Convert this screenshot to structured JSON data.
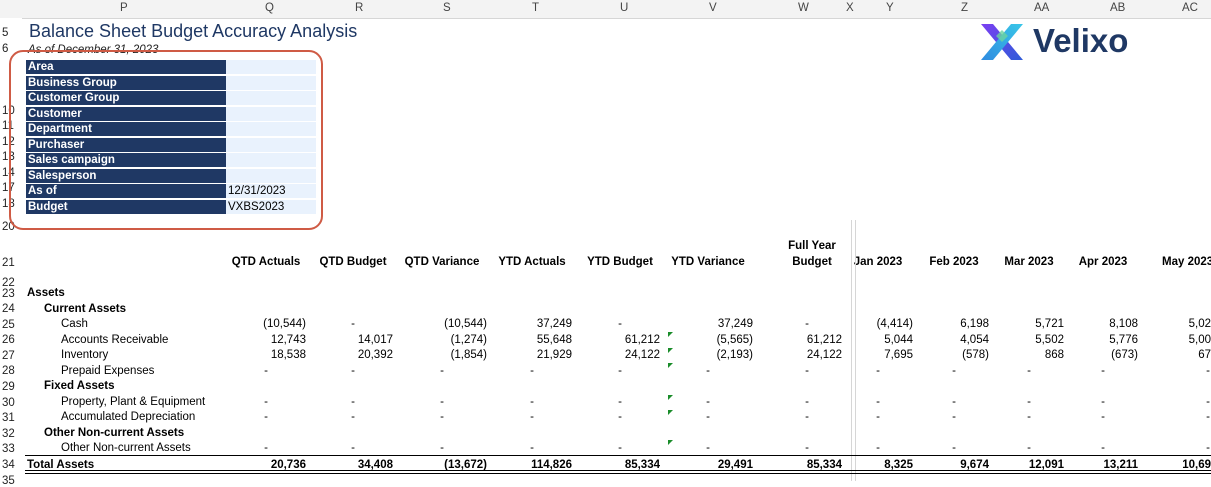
{
  "columns": [
    "P",
    "Q",
    "R",
    "S",
    "T",
    "U",
    "V",
    "W",
    "X",
    "Y",
    "Z",
    "AA",
    "AB",
    "AC"
  ],
  "row_numbers": [
    "5",
    "6",
    "",
    "",
    "",
    "10",
    "11",
    "12",
    "13",
    "14",
    "17",
    "18",
    "20",
    "21",
    "22",
    "23",
    "24",
    "25",
    "26",
    "27",
    "28",
    "29",
    "30",
    "31",
    "32",
    "33",
    "34",
    "35"
  ],
  "report": {
    "title": "Balance Sheet Budget Accuracy Analysis",
    "as_of_line": "As of December 31, 2023"
  },
  "logo": {
    "text": "Velixo",
    "icon": "velixo-x-logo"
  },
  "filters": [
    {
      "label": "Area",
      "value": ""
    },
    {
      "label": "Business Group",
      "value": ""
    },
    {
      "label": "Customer Group",
      "value": ""
    },
    {
      "label": "Customer",
      "value": ""
    },
    {
      "label": "Department",
      "value": ""
    },
    {
      "label": "Purchaser",
      "value": ""
    },
    {
      "label": "Sales campaign",
      "value": ""
    },
    {
      "label": "Salesperson",
      "value": ""
    },
    {
      "label": "As of",
      "value": "12/31/2023"
    },
    {
      "label": "Budget",
      "value": "VXBS2023"
    }
  ],
  "table": {
    "headers": [
      "QTD Actuals",
      "QTD Budget",
      "QTD Variance",
      "YTD Actuals",
      "YTD Budget",
      "YTD Variance",
      "Full Year Budget",
      "Jan 2023",
      "Feb 2023",
      "Mar 2023",
      "Apr 2023",
      "May 2023"
    ],
    "header_fy_line1": "Full Year",
    "header_fy_line2": "Budget",
    "rows": [
      {
        "label": "Assets",
        "style": "section",
        "values": []
      },
      {
        "label": "Current Assets",
        "style": "group",
        "values": []
      },
      {
        "label": "Cash",
        "style": "item",
        "values": [
          "(10,544)",
          "-",
          "(10,544)",
          "37,249",
          "-",
          "37,249",
          "-",
          "(4,414)",
          "6,198",
          "5,721",
          "8,108",
          "5,02"
        ]
      },
      {
        "label": "Accounts Receivable",
        "style": "item",
        "values": [
          "12,743",
          "14,017",
          "(1,274)",
          "55,648",
          "61,212",
          "(5,565)",
          "61,212",
          "5,044",
          "4,054",
          "5,502",
          "5,776",
          "5,00"
        ]
      },
      {
        "label": "Inventory",
        "style": "item",
        "values": [
          "18,538",
          "20,392",
          "(1,854)",
          "21,929",
          "24,122",
          "(2,193)",
          "24,122",
          "7,695",
          "(578)",
          "868",
          "(673)",
          "67"
        ]
      },
      {
        "label": "Prepaid Expenses",
        "style": "item",
        "values": [
          "-",
          "-",
          "-",
          "-",
          "-",
          "-",
          "-",
          "-",
          "-",
          "-",
          "-",
          "-"
        ]
      },
      {
        "label": "Fixed Assets",
        "style": "group",
        "values": []
      },
      {
        "label": "Property, Plant & Equipment",
        "style": "item",
        "values": [
          "-",
          "-",
          "-",
          "-",
          "-",
          "-",
          "-",
          "-",
          "-",
          "-",
          "-",
          "-"
        ]
      },
      {
        "label": "Accumulated Depreciation",
        "style": "item",
        "values": [
          "-",
          "-",
          "-",
          "-",
          "-",
          "-",
          "-",
          "-",
          "-",
          "-",
          "-",
          "-"
        ]
      },
      {
        "label": "Other Non-current Assets",
        "style": "group",
        "values": []
      },
      {
        "label": "Other Non-current Assets",
        "style": "item",
        "values": [
          "-",
          "-",
          "-",
          "-",
          "-",
          "-",
          "-",
          "-",
          "-",
          "-",
          "-",
          "-"
        ]
      },
      {
        "label": "Total Assets",
        "style": "total",
        "values": [
          "20,736",
          "34,408",
          "(13,672)",
          "114,826",
          "85,334",
          "29,491",
          "85,334",
          "8,325",
          "9,674",
          "12,091",
          "13,211",
          "10,69"
        ]
      }
    ]
  },
  "colors": {
    "header_fill": "#1f3864",
    "value_fill": "#e9f2fd",
    "highlight_border": "#cf5b45",
    "indicator": "#1a8c2a"
  }
}
